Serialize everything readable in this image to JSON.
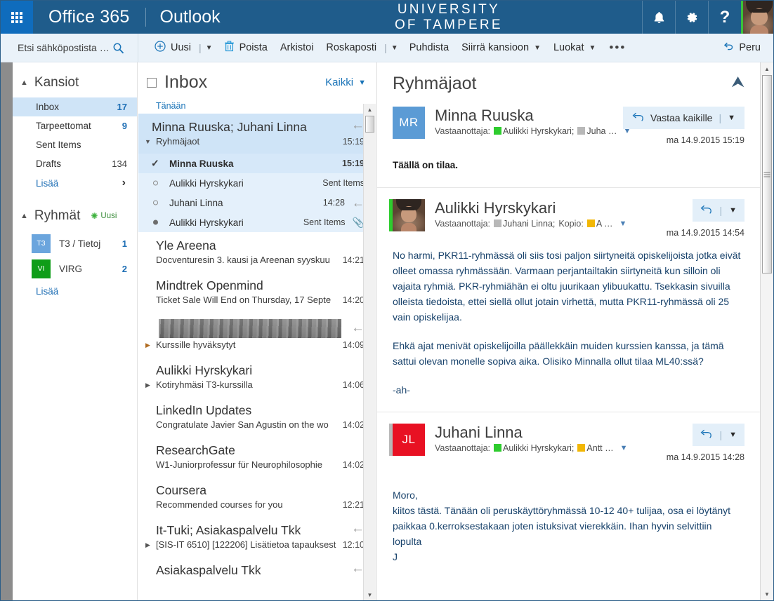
{
  "suite": {
    "waffle_icon": "app-launcher-icon",
    "office_label": "Office 365",
    "app_label": "Outlook",
    "org_line1": "UNIVERSITY",
    "org_line2": "OF TAMPERE",
    "bell_icon": "notifications-bell-icon",
    "gear_icon": "settings-gear-icon",
    "help_label": "?",
    "avatar_name": "user-avatar",
    "bg_color": "#1f5c8b",
    "waffle_color": "#0f6cbd",
    "avatar_border_color": "#3ac13a"
  },
  "commandbar": {
    "search_value": "Etsi sähköpostista ja …",
    "search_placeholder": "Etsi sähköpostista ja …",
    "search_icon": "search-icon",
    "items": [
      {
        "label": "Uusi",
        "icon": "plus-circle-icon",
        "split": true
      },
      {
        "label": "Poista",
        "icon": "trash-icon",
        "split": false
      },
      {
        "label": "Arkistoi",
        "icon": "",
        "split": false
      },
      {
        "label": "Roskaposti",
        "icon": "",
        "split": true
      },
      {
        "label": "Puhdista",
        "icon": "",
        "split": false
      },
      {
        "label": "Siirrä kansioon",
        "icon": "",
        "split": false,
        "chevron": true
      },
      {
        "label": "Luokat",
        "icon": "",
        "split": false,
        "chevron": true
      }
    ],
    "overflow_label": "•••",
    "undo_label": "Peru",
    "undo_icon": "undo-icon"
  },
  "folderpane": {
    "folders_header": "Kansiot",
    "folders": [
      {
        "name": "Inbox",
        "count": "17",
        "selected": true
      },
      {
        "name": "Tarpeettomat",
        "count": "9",
        "selected": false
      },
      {
        "name": "Sent Items",
        "count": "",
        "selected": false
      },
      {
        "name": "Drafts",
        "count": "134",
        "selected": false,
        "plain_count": true
      }
    ],
    "folders_more": "Lisää",
    "groups_header": "Ryhmät",
    "groups_new": "Uusi",
    "groups": [
      {
        "initials": "T3",
        "name": "T3 / Tietoj",
        "count": "1",
        "color": "#6ba5dd"
      },
      {
        "initials": "VI",
        "name": "VIRG",
        "count": "2",
        "color": "#0f9d18"
      }
    ],
    "groups_more": "Lisää"
  },
  "messagelist": {
    "title": "Inbox",
    "filter_label": "Kaikki",
    "day_group": "Tänään",
    "selected_conversation": {
      "from": "Minna Ruuska; Juhani Linna",
      "subject": "Ryhmäjaot",
      "time": "15:19",
      "has_reply_arrow": true,
      "children": [
        {
          "name": "Minna Ruuska",
          "meta": "15:19",
          "state": "read-check",
          "arrow": false,
          "clip": false
        },
        {
          "name": "Aulikki Hyrskykari",
          "meta": "Sent Items",
          "state": "hollow",
          "arrow": false,
          "clip": false
        },
        {
          "name": "Juhani Linna",
          "meta": "14:28",
          "state": "hollow",
          "arrow": true,
          "clip": false
        },
        {
          "name": "Aulikki Hyrskykari",
          "meta": "Sent Items",
          "state": "filled",
          "arrow": false,
          "clip": true
        }
      ]
    },
    "messages": [
      {
        "from": "Yle Areena",
        "subject": "Docventuresin 3. kausi ja Areenan syyskuu",
        "time": "14:21",
        "arrow": false,
        "expander": ""
      },
      {
        "from": "Mindtrek Openmind",
        "subject": "Ticket Sale Will End on Thursday, 17 Septe",
        "time": "14:20",
        "arrow": false,
        "expander": ""
      },
      {
        "from": "",
        "redacted": true,
        "subject": "Kurssille hyväksytyt",
        "time": "14:09",
        "arrow": true,
        "expander": "right"
      },
      {
        "from": "Aulikki Hyrskykari",
        "subject": "Kotiryhmäsi T3-kurssilla",
        "time": "14:06",
        "arrow": false,
        "expander": "rightg"
      },
      {
        "from": "LinkedIn Updates",
        "subject": "Congratulate Javier San Agustin on the wo",
        "time": "14:02",
        "arrow": false,
        "expander": ""
      },
      {
        "from": "ResearchGate",
        "subject": "W1-Juniorprofessur für Neurophilosophie",
        "time": "14:02",
        "arrow": false,
        "expander": ""
      },
      {
        "from": "Coursera",
        "subject": "Recommended courses for you",
        "time": "12:21",
        "arrow": false,
        "expander": ""
      },
      {
        "from": "It-Tuki; Asiakaspalvelu Tkk",
        "subject": "[SIS-IT 6510] [122206] Lisätietoa tapauksest",
        "time": "12:10",
        "arrow": true,
        "expander": "rightg"
      },
      {
        "from": "Asiakaspalvelu Tkk",
        "subject": "",
        "time": "",
        "arrow": true,
        "expander": ""
      }
    ]
  },
  "readingpane": {
    "subject": "Ryhmäjaot",
    "collapse_icon": "collapse-chevrons-icon",
    "messages": [
      {
        "avatar_type": "initials",
        "initials": "MR",
        "avatar_color": "#5b9bd5",
        "sender": "Minna Ruuska",
        "to_label": "Vastaanottaja:",
        "recipients": [
          {
            "name": "Aulikki Hyrskykari;",
            "chip": "#2ecc2e"
          },
          {
            "name": "Juha …",
            "chip": "#b8b8b8"
          }
        ],
        "date": "ma 14.9.2015 15:19",
        "reply_label": "Vastaa kaikille",
        "reply_icon": "reply-all-icon",
        "reply_full": true,
        "body": [
          "Täällä on tilaa."
        ],
        "body_bold": true
      },
      {
        "avatar_type": "photo",
        "initials": "",
        "avatar_color": "#2ecc2e",
        "sender": "Aulikki Hyrskykari",
        "to_label": "Vastaanottaja:",
        "recipients": [
          {
            "name": "Juhani Linna;",
            "chip": "#b8b8b8"
          }
        ],
        "cc_label": "Kopio:",
        "cc_recipients": [
          {
            "name": "A …",
            "chip": "#f2b705"
          }
        ],
        "date": "ma 14.9.2015 14:54",
        "reply_label": "",
        "reply_icon": "reply-icon",
        "reply_full": false,
        "body": [
          "No harmi, PKR11-ryhmässä oli siis tosi paljon siirtyneitä opiskelijoista jotka eivät olleet omassa ryhmässään. Varmaan perjantailtakin siirtyneitä kun silloin oli vajaita ryhmiä. PKR-ryhmiähän ei oltu juurikaan ylibuukattu. Tsekkasin sivuilla olleista tiedoista, ettei siellä ollut jotain virhettä, mutta PKR11-ryhmässä  oli 25 vain opiskelijaa.",
          "Ehkä ajat menivät opiskelijoilla päällekkäin muiden kurssien kanssa, ja tämä sattui olevan monelle sopiva aika. Olisiko Minnalla ollut tilaa ML40:ssä?",
          "-ah-"
        ],
        "body_bold": false
      },
      {
        "avatar_type": "initials",
        "initials": "JL",
        "avatar_color": "#e81123",
        "sender": "Juhani Linna",
        "to_label": "Vastaanottaja:",
        "recipients": [
          {
            "name": "Aulikki Hyrskykari;",
            "chip": "#2ecc2e"
          },
          {
            "name": "Antt …",
            "chip": "#f2b705"
          }
        ],
        "date": "ma 14.9.2015 14:28",
        "reply_label": "",
        "reply_icon": "reply-icon",
        "reply_full": false,
        "body": [
          "Moro,\nkiitos tästä. Tänään oli peruskäyttöryhmässä 10-12 40+ tulijaa, osa ei löytänyt paikkaa 0.kerroksestakaan joten istuksivat vierekkäin. Ihan hyvin selvittiin lopulta\nJ"
        ],
        "body_bold": false
      }
    ]
  }
}
